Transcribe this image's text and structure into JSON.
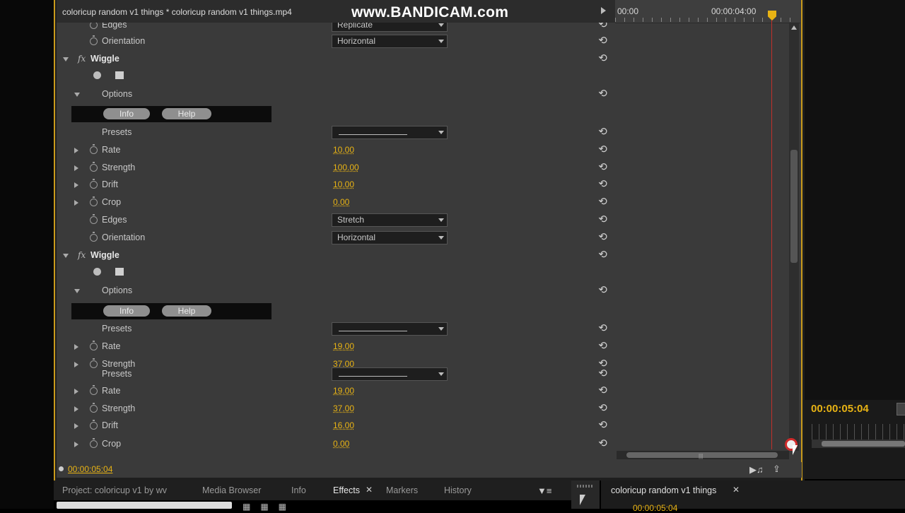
{
  "header": {
    "sequence_title": "coloricup random v1 things * coloricup random v1 things.mp4",
    "watermark": "www.BANDICAM.com"
  },
  "timeline_ruler": {
    "start_time": "00:00",
    "end_time": "00:00:04:00"
  },
  "rows": [
    {
      "type": "param",
      "label": "Edges",
      "dropdown": "Replicate",
      "stopwatch": true
    },
    {
      "type": "param",
      "label": "Orientation",
      "dropdown": "Horizontal",
      "stopwatch": true
    },
    {
      "type": "effect",
      "label": "Wiggle",
      "fx": "fx"
    },
    {
      "type": "tools"
    },
    {
      "type": "group",
      "label": "Options"
    },
    {
      "type": "infobar",
      "info": "Info",
      "help": "Help"
    },
    {
      "type": "presets",
      "label": "Presets"
    },
    {
      "type": "param",
      "label": "Rate",
      "value": "10.00",
      "expand": true
    },
    {
      "type": "param",
      "label": "Strength",
      "value": "100.00",
      "expand": true
    },
    {
      "type": "param",
      "label": "Drift",
      "value": "10.00",
      "expand": true
    },
    {
      "type": "param",
      "label": "Crop",
      "value": "0.00",
      "expand": true
    },
    {
      "type": "param",
      "label": "Edges",
      "dropdown": "Stretch"
    },
    {
      "type": "param",
      "label": "Orientation",
      "dropdown": "Horizontal"
    },
    {
      "type": "effect",
      "label": "Wiggle",
      "fx": "fx"
    },
    {
      "type": "tools"
    },
    {
      "type": "group",
      "label": "Options"
    },
    {
      "type": "infobar",
      "info": "Info",
      "help": "Help"
    },
    {
      "type": "presets",
      "label": "Presets"
    },
    {
      "type": "param",
      "label": "Rate",
      "value": "19.00",
      "expand": true
    },
    {
      "type": "param",
      "label": "Strength",
      "value": "37.00",
      "expand": true
    },
    {
      "type": "presets-overlap",
      "label": "Presets"
    },
    {
      "type": "param",
      "label": "Rate",
      "value": "19.00",
      "expand": true
    },
    {
      "type": "param",
      "label": "Strength",
      "value": "37.00",
      "expand": true
    },
    {
      "type": "param",
      "label": "Drift",
      "value": "16.00",
      "expand": true
    },
    {
      "type": "param",
      "label": "Crop",
      "value": "0.00",
      "expand": true
    }
  ],
  "footer": {
    "current_time": "00:00:05:04"
  },
  "program_monitor": {
    "timecode": "00:00:05:04"
  },
  "bottom_tabs": [
    {
      "label": "Project: coloricup v1 by wv",
      "active": false
    },
    {
      "label": "Media Browser",
      "active": false
    },
    {
      "label": "Info",
      "active": false
    },
    {
      "label": "Effects",
      "active": true
    },
    {
      "label": "Markers",
      "active": false
    },
    {
      "label": "History",
      "active": false
    }
  ],
  "timeline_panel": {
    "tab_label": "coloricup random v1 things",
    "time": "00:00:05:04"
  },
  "icons": {
    "reset": "reset-icon",
    "stopwatch": "stopwatch-icon",
    "expand": "triangle-right-icon",
    "collapse": "triangle-down-icon"
  },
  "colors": {
    "accent": "#e8b314",
    "panel_bg": "#3a3a3a",
    "panel_border": "#c99a1b",
    "playhead": "#c0302a"
  }
}
